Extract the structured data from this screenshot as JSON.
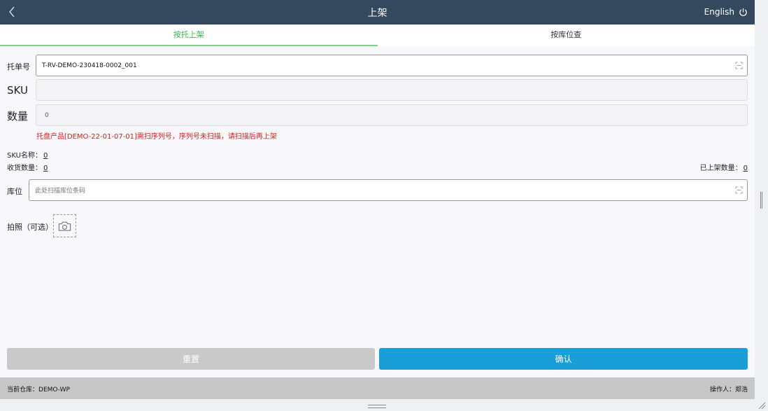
{
  "header": {
    "title": "上架",
    "language_label": "English"
  },
  "tabs": [
    {
      "label": "按托上架",
      "active": true
    },
    {
      "label": "按库位查",
      "active": false
    }
  ],
  "form": {
    "pallet_label": "托单号",
    "pallet_value": "T-RV-DEMO-230418-0002_001",
    "sku_label": "SKU",
    "sku_value": "",
    "qty_label": "数量",
    "qty_value": "0",
    "error_message": "托盘产品[DEMO-22-01-07-01]需扫序列号，序列号未扫描，请扫描后再上架",
    "sku_name_label": "SKU名称：",
    "sku_name_value": "0",
    "received_qty_label": "收货数量：",
    "received_qty_value": "0",
    "shelved_qty_label": "已上架数量：",
    "shelved_qty_value": "0",
    "location_label": "库位",
    "location_placeholder": "此处扫描库位条码",
    "photo_label": "拍照（可选）"
  },
  "actions": {
    "reset_label": "重置",
    "confirm_label": "确认"
  },
  "footer": {
    "warehouse_label": "当前仓库：",
    "warehouse_value": "DEMO-WP",
    "operator_label": "操作人：",
    "operator_value": "郑浩"
  },
  "icons": {
    "back": "chevron-left-icon",
    "power": "power-icon",
    "scan": "scan-icon",
    "camera": "camera-icon"
  },
  "colors": {
    "header_bg": "#34495e",
    "active_tab": "#3cb451",
    "confirm_bg": "#199ed8",
    "reset_bg": "#c9c9c9",
    "error": "#d4201c",
    "footer_bg": "#c7c7c7"
  }
}
